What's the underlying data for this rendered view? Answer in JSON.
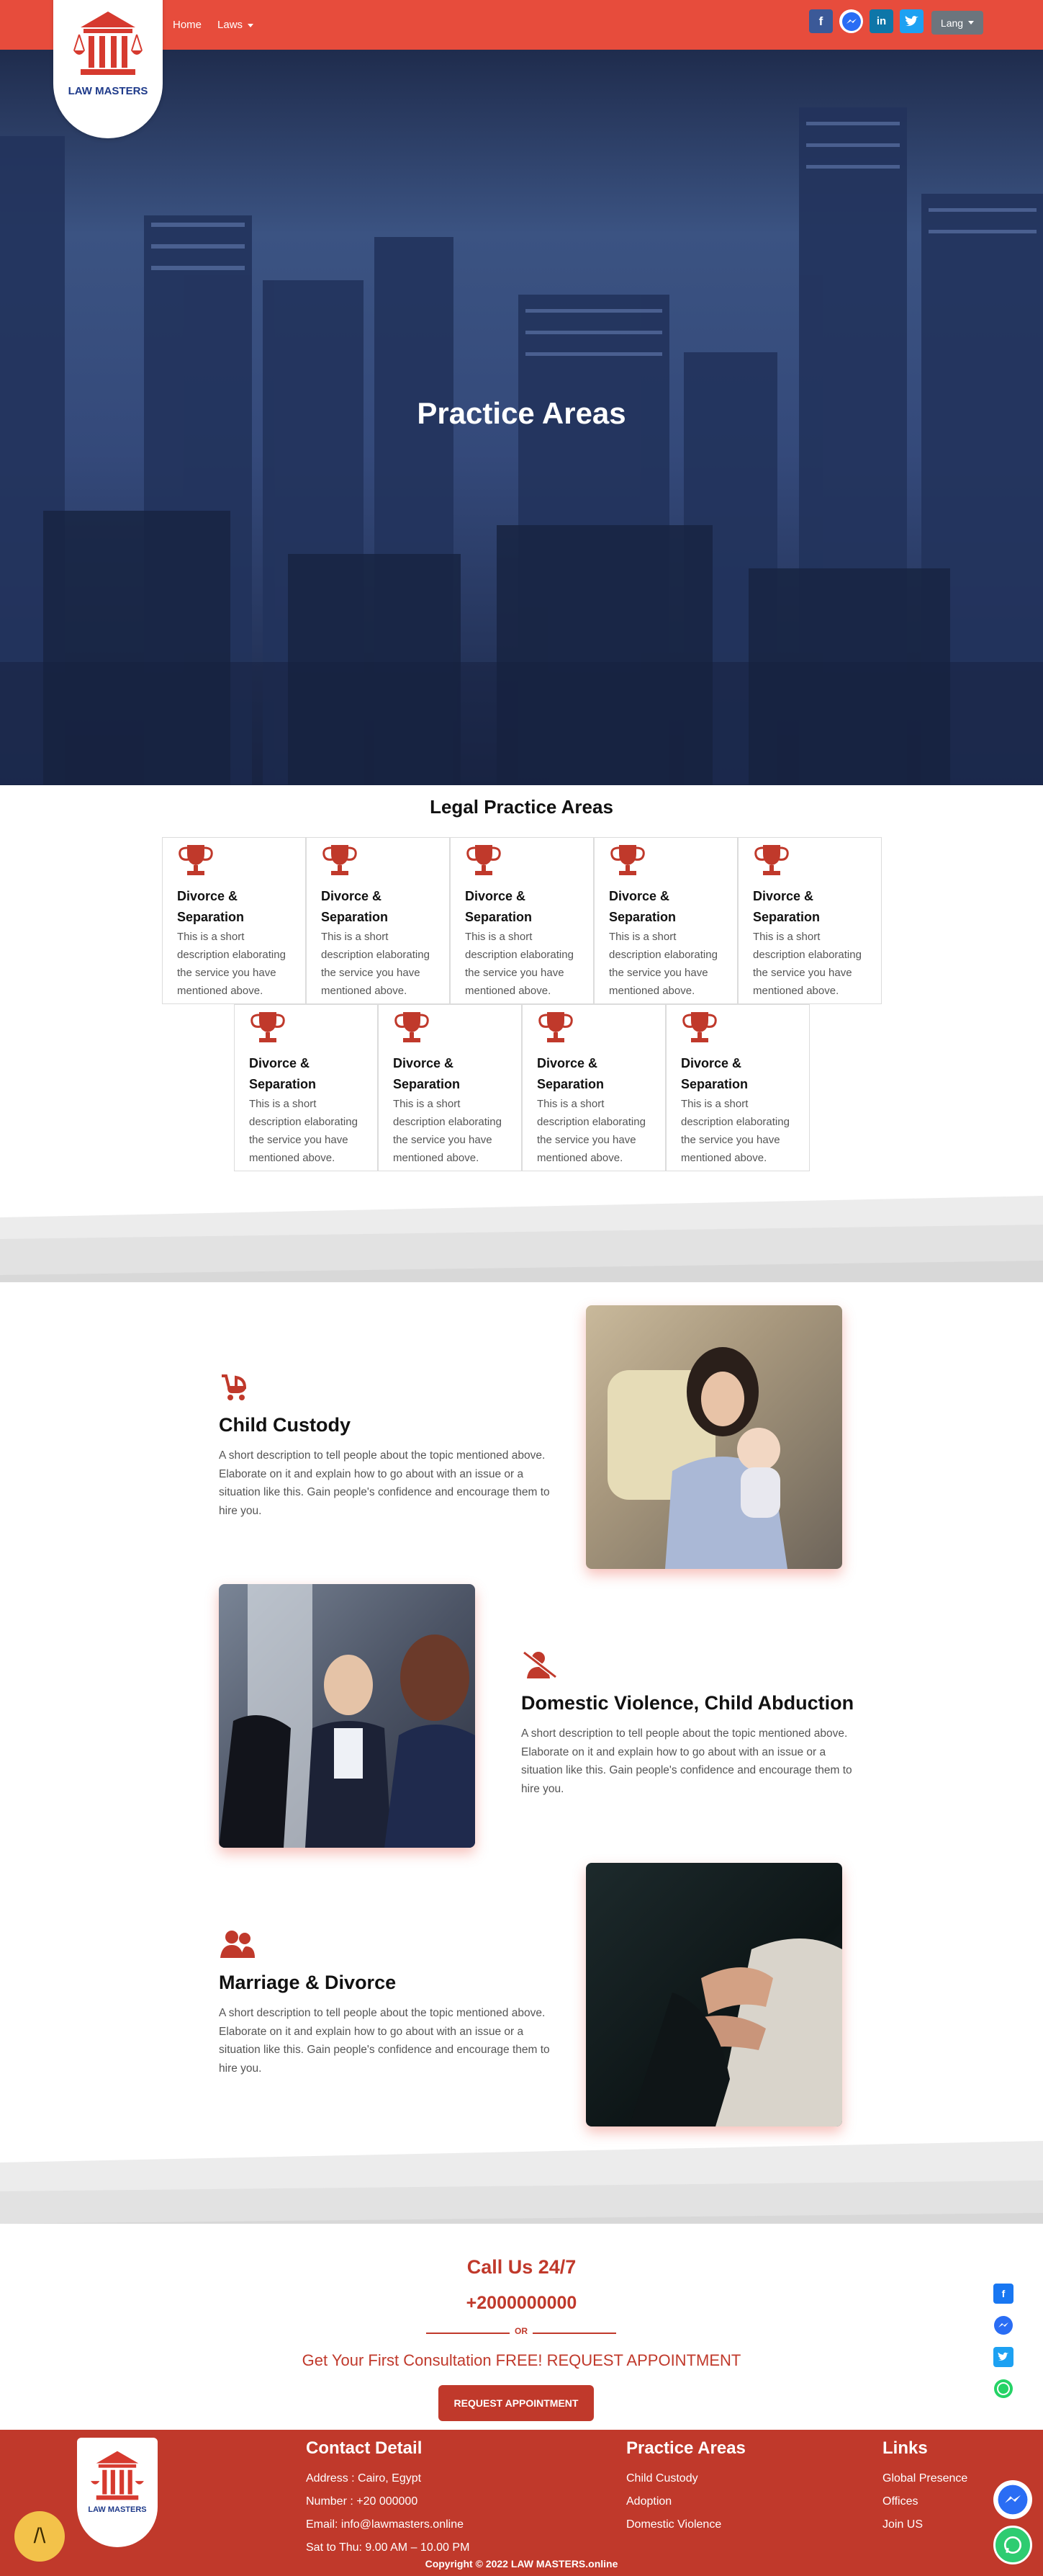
{
  "nav": {
    "home": "Home",
    "laws": "Laws",
    "lang": "Lang",
    "social": [
      "facebook-icon",
      "messenger-icon",
      "linkedin-icon",
      "twitter-icon"
    ]
  },
  "brand": {
    "name": "LAW MASTERS",
    "logo_icon": "courthouse-scales-icon"
  },
  "hero": {
    "title": "Practice Areas"
  },
  "legal": {
    "title": "Legal Practice Areas",
    "cards": [
      {
        "title": "Divorce & Separation",
        "desc": "This is a short description elaborating the service you have mentioned above."
      },
      {
        "title": "Divorce & Separation",
        "desc": "This is a short description elaborating the service you have mentioned above."
      },
      {
        "title": "Divorce & Separation",
        "desc": "This is a short description elaborating the service you have mentioned above."
      },
      {
        "title": "Divorce & Separation",
        "desc": "This is a short description elaborating the service you have mentioned above."
      },
      {
        "title": "Divorce & Separation",
        "desc": "This is a short description elaborating the service you have mentioned above."
      },
      {
        "title": "Divorce & Separation",
        "desc": "This is a short description elaborating the service you have mentioned above."
      },
      {
        "title": "Divorce & Separation",
        "desc": "This is a short description elaborating the service you have mentioned above."
      },
      {
        "title": "Divorce & Separation",
        "desc": "This is a short description elaborating the service you have mentioned above."
      },
      {
        "title": "Divorce & Separation",
        "desc": "This is a short description elaborating the service you have mentioned above."
      }
    ]
  },
  "features": [
    {
      "icon": "baby-carriage-icon",
      "title": "Child Custody",
      "desc": "A short description to tell people about the topic mentioned above. Elaborate on it and explain how to go about with an issue or a situation like this. Gain people's confidence and encourage them to hire you."
    },
    {
      "icon": "user-slash-icon",
      "title": "Domestic Violence, Child Abduction",
      "desc": "A short description to tell people about the topic mentioned above. Elaborate on it and explain how to go about with an issue or a situation like this. Gain people's confidence and encourage them to hire you."
    },
    {
      "icon": "users-icon",
      "title": "Marriage & Divorce",
      "desc": "A short description to tell people about the topic mentioned above. Elaborate on it and explain how to go about with an issue or a situation like this. Gain people's confidence and encourage them to hire you."
    }
  ],
  "call": {
    "title": "Call Us 24/7",
    "number": "+2000000000",
    "or": "OR",
    "consult": "Get Your First Consultation FREE! REQUEST APPOINTMENT",
    "button": "REQUEST APPOINTMENT"
  },
  "footer": {
    "contact": {
      "title": "Contact Detail",
      "items": [
        "Address : Cairo, Egypt",
        "Number : +20 000000",
        "Email: info@lawmasters.online",
        "Sat to Thu: 9.00 AM – 10.00 PM"
      ]
    },
    "practice": {
      "title": "Practice Areas",
      "items": [
        "Child Custody",
        "Adoption",
        "Domestic Violence"
      ]
    },
    "links": {
      "title": "Links",
      "items": [
        "Global Presence",
        "Offices",
        "Join US"
      ]
    },
    "copyright": "Copyright © 2022 LAW MASTERS.online"
  },
  "colors": {
    "primary": "#e74c3c",
    "dark_red": "#c0392b",
    "hero_blue": "#34497a"
  }
}
